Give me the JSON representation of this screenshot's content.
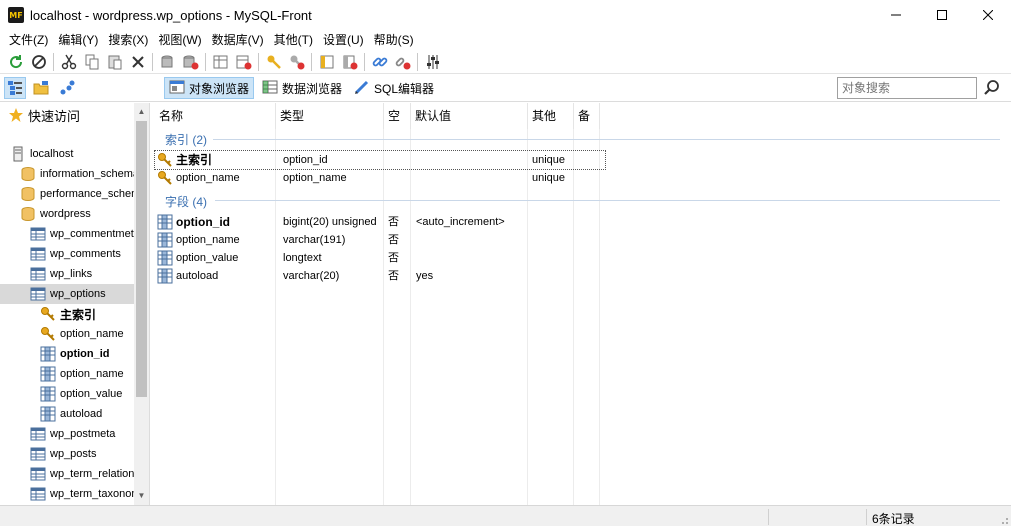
{
  "window": {
    "title": "localhost - wordpress.wp_options - MySQL-Front",
    "logo_text": "MF",
    "controls": [
      "minimize-icon",
      "maximize-icon",
      "close-icon"
    ]
  },
  "menu": [
    "文件(Z)",
    "编辑(Y)",
    "搜索(X)",
    "视图(W)",
    "数据库(V)",
    "其他(T)",
    "设置(U)",
    "帮助(S)"
  ],
  "toolbar2": {
    "tabs": [
      {
        "label": "对象浏览器",
        "active": true,
        "icon": "object-browser-icon"
      },
      {
        "label": "数据浏览器",
        "active": false,
        "icon": "data-browser-icon"
      },
      {
        "label": "SQL编辑器",
        "active": false,
        "icon": "sql-editor-icon"
      }
    ],
    "search_placeholder": "对象搜索"
  },
  "tree": {
    "quick_access": "快速访问",
    "items": [
      {
        "label": "localhost",
        "icon": "server-icon",
        "indent": 0
      },
      {
        "label": "information_schema",
        "icon": "database-icon",
        "indent": 1
      },
      {
        "label": "performance_schema",
        "icon": "database-icon",
        "indent": 1
      },
      {
        "label": "wordpress",
        "icon": "database-icon",
        "indent": 1
      },
      {
        "label": "wp_commentmeta",
        "icon": "table-icon",
        "indent": 2
      },
      {
        "label": "wp_comments",
        "icon": "table-icon",
        "indent": 2
      },
      {
        "label": "wp_links",
        "icon": "table-icon",
        "indent": 2
      },
      {
        "label": "wp_options",
        "icon": "table-icon",
        "indent": 2,
        "selected": true
      },
      {
        "label": "主索引",
        "icon": "key-icon",
        "indent": 3,
        "bold": true
      },
      {
        "label": "option_name",
        "icon": "key-icon",
        "indent": 3
      },
      {
        "label": "option_id",
        "icon": "field-icon",
        "indent": 3,
        "bold": true
      },
      {
        "label": "option_name",
        "icon": "field-icon",
        "indent": 3
      },
      {
        "label": "option_value",
        "icon": "field-icon",
        "indent": 3
      },
      {
        "label": "autoload",
        "icon": "field-icon",
        "indent": 3
      },
      {
        "label": "wp_postmeta",
        "icon": "table-icon",
        "indent": 2
      },
      {
        "label": "wp_posts",
        "icon": "table-icon",
        "indent": 2
      },
      {
        "label": "wp_term_relationships",
        "icon": "table-icon",
        "indent": 2
      },
      {
        "label": "wp_term_taxonomy",
        "icon": "table-icon",
        "indent": 2
      }
    ]
  },
  "grid": {
    "columns": [
      "名称",
      "类型",
      "空",
      "默认值",
      "其他",
      "备"
    ],
    "index_group": "索引 (2)",
    "indexes": [
      {
        "name": "主索引",
        "type": "option_id",
        "other": "unique",
        "bold": true
      },
      {
        "name": "option_name",
        "type": "option_name",
        "other": "unique"
      }
    ],
    "field_group": "字段 (4)",
    "fields": [
      {
        "name": "option_id",
        "type": "bigint(20) unsigned",
        "null": "否",
        "default": "<auto_increment>",
        "bold": true
      },
      {
        "name": "option_name",
        "type": "varchar(191)",
        "null": "否",
        "default": ""
      },
      {
        "name": "option_value",
        "type": "longtext",
        "null": "否",
        "default": ""
      },
      {
        "name": "autoload",
        "type": "varchar(20)",
        "null": "否",
        "default": "yes"
      }
    ]
  },
  "status": {
    "records": "6条记录"
  }
}
